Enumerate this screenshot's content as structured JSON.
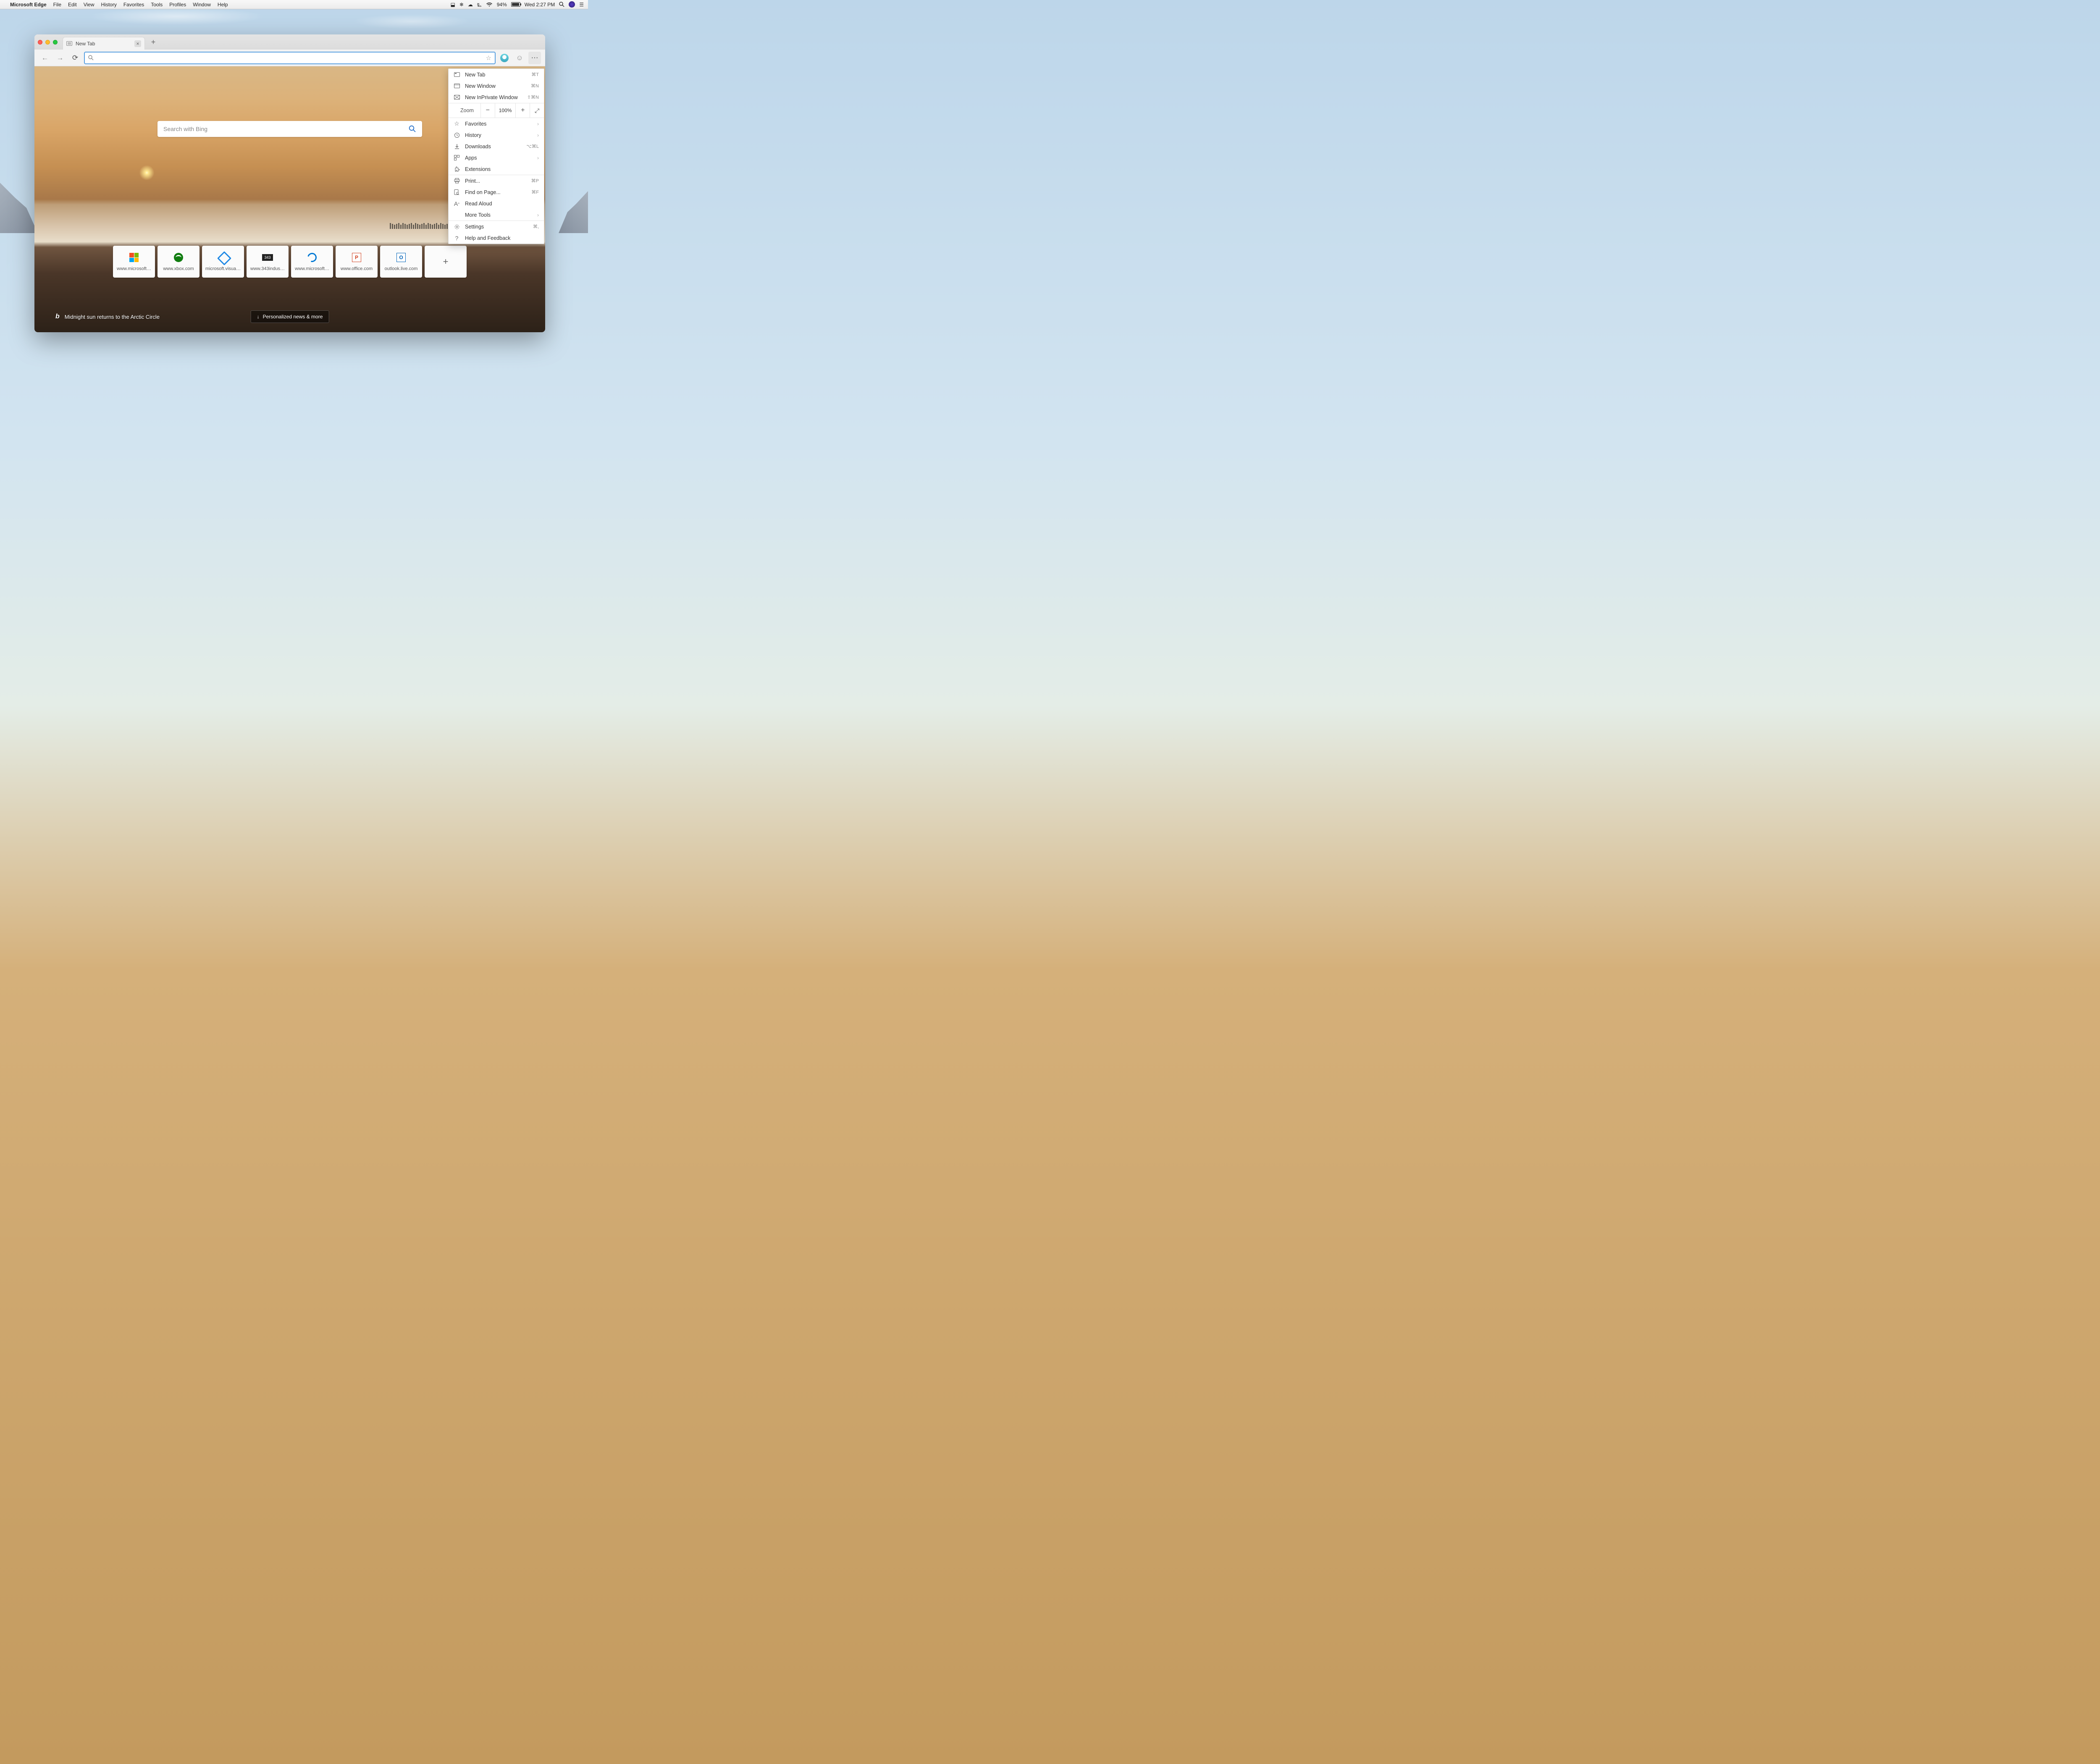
{
  "menubar": {
    "app": "Microsoft Edge",
    "items": [
      "File",
      "Edit",
      "View",
      "History",
      "Favorites",
      "Tools",
      "Profiles",
      "Window",
      "Help"
    ],
    "battery_pct": "94%",
    "clock": "Wed 2:27 PM"
  },
  "tab": {
    "title": "New Tab"
  },
  "page": {
    "search_placeholder": "Search with Bing",
    "caption": "Midnight sun returns to the Arctic Circle",
    "news_button": "Personalized news & more"
  },
  "tiles": [
    {
      "label": "www.microsoft…",
      "icon": "microsoft"
    },
    {
      "label": "www.xbox.com",
      "icon": "xbox"
    },
    {
      "label": "microsoft.visua…",
      "icon": "vs"
    },
    {
      "label": "www.343indus…",
      "icon": "343"
    },
    {
      "label": "www.microsoft…",
      "icon": "edge"
    },
    {
      "label": "www.office.com",
      "icon": "ppt"
    },
    {
      "label": "outlook.live.com",
      "icon": "outlook"
    }
  ],
  "menu": {
    "new_tab": "New Tab",
    "new_tab_k": "⌘T",
    "new_window": "New Window",
    "new_window_k": "⌘N",
    "inprivate": "New InPrivate Window",
    "inprivate_k": "⇧⌘N",
    "zoom_label": "Zoom",
    "zoom_value": "100%",
    "favorites": "Favorites",
    "history": "History",
    "downloads": "Downloads",
    "downloads_k": "⌥⌘L",
    "apps": "Apps",
    "extensions": "Extensions",
    "print": "Print...",
    "print_k": "⌘P",
    "find": "Find on Page...",
    "find_k": "⌘F",
    "read_aloud": "Read Aloud",
    "more_tools": "More Tools",
    "settings": "Settings",
    "settings_k": "⌘,",
    "help": "Help and Feedback"
  }
}
